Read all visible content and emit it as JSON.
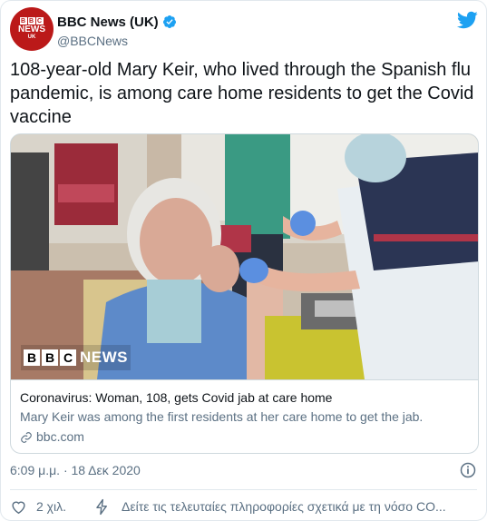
{
  "account": {
    "display_name": "BBC News (UK)",
    "handle": "@BBCNews",
    "avatar_bbc": [
      "B",
      "B",
      "C"
    ],
    "avatar_news": "NEWS",
    "avatar_uk": "UK",
    "verified": true
  },
  "tweet": {
    "text": "108-year-old Mary Keir, who lived through the Spanish flu pandemic, is among care home residents to get the Covid vaccine",
    "timestamp": "6:09 μ.μ. · 18 Δεκ 2020"
  },
  "card": {
    "image_logo_letters": [
      "B",
      "B",
      "C"
    ],
    "image_logo_word": "NEWS",
    "title": "Coronavirus: Woman, 108, gets Covid jab at care home",
    "description": "Mary Keir was among the first residents at her care home to get the jab.",
    "domain": "bbc.com"
  },
  "footer": {
    "likes": "2 χιλ.",
    "info_prompt": "Δείτε τις τελευταίες πληροφορίες σχετικά με τη νόσο CO..."
  },
  "colors": {
    "brand_red": "#bb1919",
    "twitter_blue": "#1da1f2",
    "secondary_text": "#5b7083",
    "border": "#cfd9de"
  },
  "icons": [
    "verified-badge-icon",
    "twitter-bird-icon",
    "link-icon",
    "info-icon",
    "heart-icon",
    "bolt-icon"
  ]
}
